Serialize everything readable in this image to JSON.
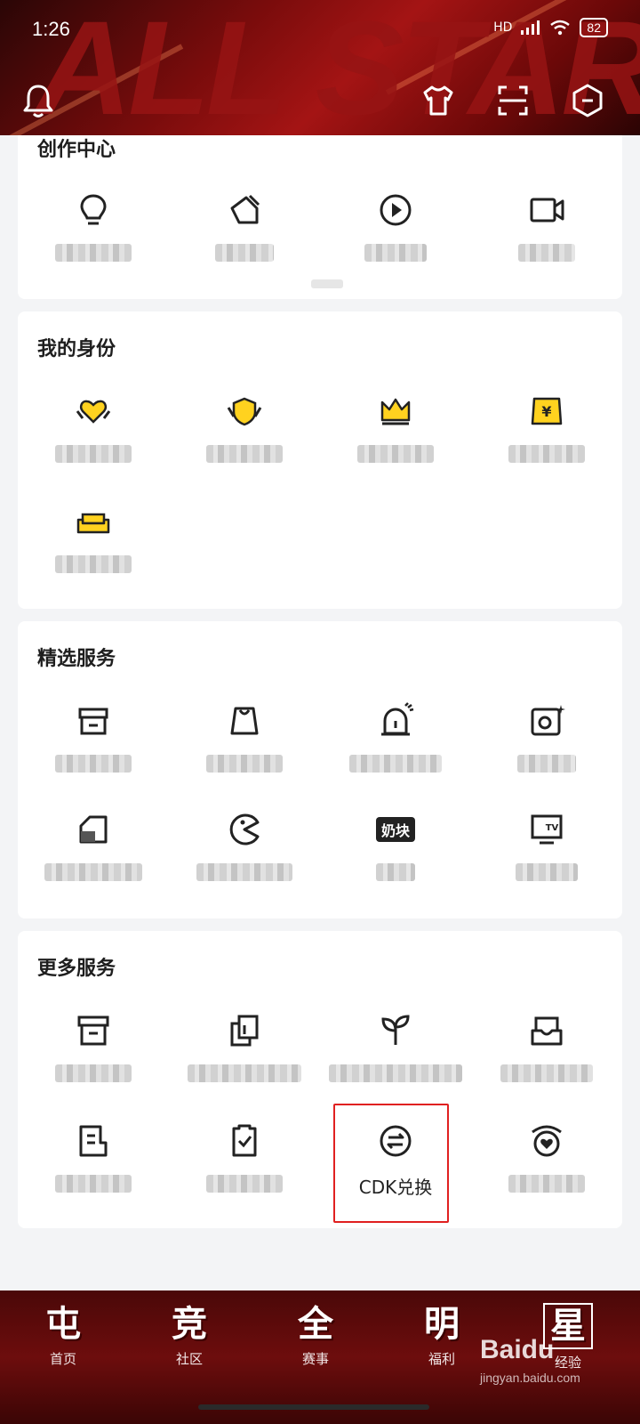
{
  "status_bar": {
    "time": "1:26",
    "network": "HD",
    "battery": "82"
  },
  "header": {
    "background_text": "ALL STAR",
    "accent_color": "#8b0f0f"
  },
  "creation_center": {
    "title": "创作中心",
    "items": [
      {
        "icon": "lightbulb-icon",
        "label": ""
      },
      {
        "icon": "pen-nib-icon",
        "label": ""
      },
      {
        "icon": "play-circle-icon",
        "label": ""
      },
      {
        "icon": "video-camera-icon",
        "label": ""
      }
    ]
  },
  "my_identity": {
    "title": "我的身份",
    "items": [
      {
        "icon": "heart-hands-icon",
        "label": ""
      },
      {
        "icon": "shield-hands-icon",
        "label": ""
      },
      {
        "icon": "crown-icon",
        "label": ""
      },
      {
        "icon": "yen-ticket-icon",
        "label": ""
      },
      {
        "icon": "sofa-icon",
        "label": ""
      }
    ]
  },
  "featured_services": {
    "title": "精选服务",
    "items": [
      {
        "icon": "store-icon",
        "label": ""
      },
      {
        "icon": "shopping-bag-icon",
        "label": ""
      },
      {
        "icon": "alarm-light-icon",
        "label": ""
      },
      {
        "icon": "camera-sparkle-icon",
        "label": ""
      },
      {
        "icon": "bag-tag-icon",
        "label": ""
      },
      {
        "icon": "pacman-icon",
        "label": ""
      },
      {
        "icon": "naikuai-logo-icon",
        "label": "",
        "logo_text": "奶块"
      },
      {
        "icon": "tv-icon",
        "label": ""
      }
    ]
  },
  "more_services": {
    "title": "更多服务",
    "items": [
      {
        "icon": "archive-box-icon",
        "label": ""
      },
      {
        "icon": "copy-document-icon",
        "label": ""
      },
      {
        "icon": "sprout-icon",
        "label": ""
      },
      {
        "icon": "inbox-tray-icon",
        "label": ""
      },
      {
        "icon": "note-document-icon",
        "label": ""
      },
      {
        "icon": "clipboard-check-icon",
        "label": ""
      },
      {
        "icon": "exchange-icon",
        "label": "CDK兑换"
      },
      {
        "icon": "heart-badge-icon",
        "label": ""
      }
    ]
  },
  "bottom_nav": {
    "items": [
      {
        "glyph": "屯",
        "label": "首页"
      },
      {
        "glyph": "竞",
        "label": "社区"
      },
      {
        "glyph": "全",
        "label": "赛事"
      },
      {
        "glyph": "明",
        "label": "福利"
      },
      {
        "glyph": "星",
        "label": "经验"
      }
    ]
  },
  "watermark": {
    "text": "Baidu",
    "sub": "jingyan.baidu.com"
  }
}
